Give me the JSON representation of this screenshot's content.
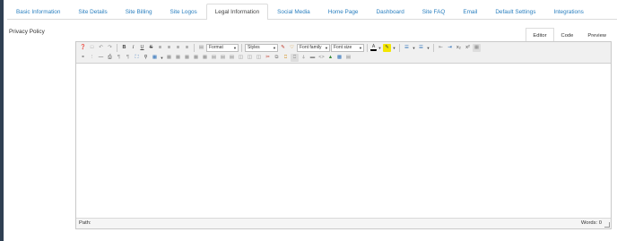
{
  "tabs": [
    {
      "label": "Basic Information"
    },
    {
      "label": "Site Details"
    },
    {
      "label": "Site Billing"
    },
    {
      "label": "Site Logos"
    },
    {
      "label": "Legal Information"
    },
    {
      "label": "Social Media"
    },
    {
      "label": "Home Page"
    },
    {
      "label": "Dashboard"
    },
    {
      "label": "Site FAQ"
    },
    {
      "label": "Email"
    },
    {
      "label": "Default Settings"
    },
    {
      "label": "Integrations"
    }
  ],
  "active_tab": "Legal Information",
  "field": {
    "label": "Privacy Policy"
  },
  "editor": {
    "modes": [
      {
        "label": "Editor"
      },
      {
        "label": "Code"
      },
      {
        "label": "Preview"
      }
    ],
    "active_mode": "Editor",
    "toolbar": {
      "format_label": "Format",
      "styles_label": "Styles",
      "font_family_label": "Font family",
      "font_size_label": "Font size",
      "bold": "B",
      "italic": "I",
      "underline": "U",
      "strike": "S"
    },
    "status": {
      "path_label": "Path:",
      "words_label": "Words: 0"
    }
  },
  "colors": {
    "tab_link": "#2a7fbf",
    "sidebar": "#2f3f52",
    "toolbar_bg": "#f0f0f0"
  }
}
